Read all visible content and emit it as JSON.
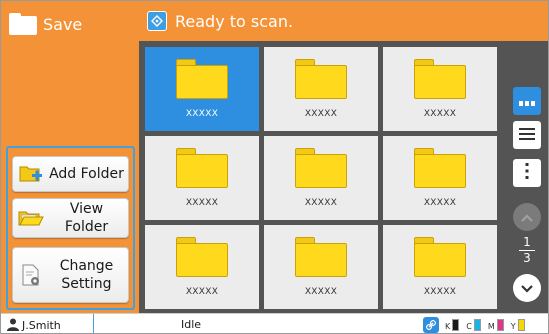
{
  "header": {
    "title": "Save",
    "status": "Ready to scan."
  },
  "actions": {
    "add_folder": "Add Folder",
    "view_folder_line1": "View",
    "view_folder_line2": "Folder",
    "change_setting_line1": "Change",
    "change_setting_line2": "Setting"
  },
  "folders": [
    {
      "name": "XXXXX",
      "selected": true
    },
    {
      "name": "XXXXX",
      "selected": false
    },
    {
      "name": "XXXXX",
      "selected": false
    },
    {
      "name": "XXXXX",
      "selected": false
    },
    {
      "name": "XXXXX",
      "selected": false
    },
    {
      "name": "XXXXX",
      "selected": false
    },
    {
      "name": "XXXXX",
      "selected": false
    },
    {
      "name": "XXXXX",
      "selected": false
    },
    {
      "name": "XXXXX",
      "selected": false
    }
  ],
  "pagination": {
    "current": "1",
    "total": "3"
  },
  "footer": {
    "user": "J.Smith",
    "machine_status": "Idle",
    "inks": [
      {
        "label": "K",
        "color": "#1a1a1a"
      },
      {
        "label": "C",
        "color": "#19b3e6"
      },
      {
        "label": "M",
        "color": "#e0358c"
      },
      {
        "label": "Y",
        "color": "#f5d800"
      }
    ]
  },
  "colors": {
    "accent_orange": "#f39237",
    "accent_blue": "#2e8fe0",
    "grid_bg": "#545454",
    "folder_yellow": "#ffd91c"
  },
  "icons": {
    "header": "folder-icon",
    "scan": "scan-icon",
    "add_folder": "add-folder-icon",
    "view_folder": "open-folder-icon",
    "change_setting": "settings-document-icon",
    "thumbnail_view": "thumbnail-view-icon",
    "list_view": "list-view-icon",
    "menu": "more-vertical-icon",
    "scroll_up": "chevron-up-icon",
    "scroll_down": "chevron-down-icon",
    "user": "user-icon",
    "link": "link-icon"
  }
}
